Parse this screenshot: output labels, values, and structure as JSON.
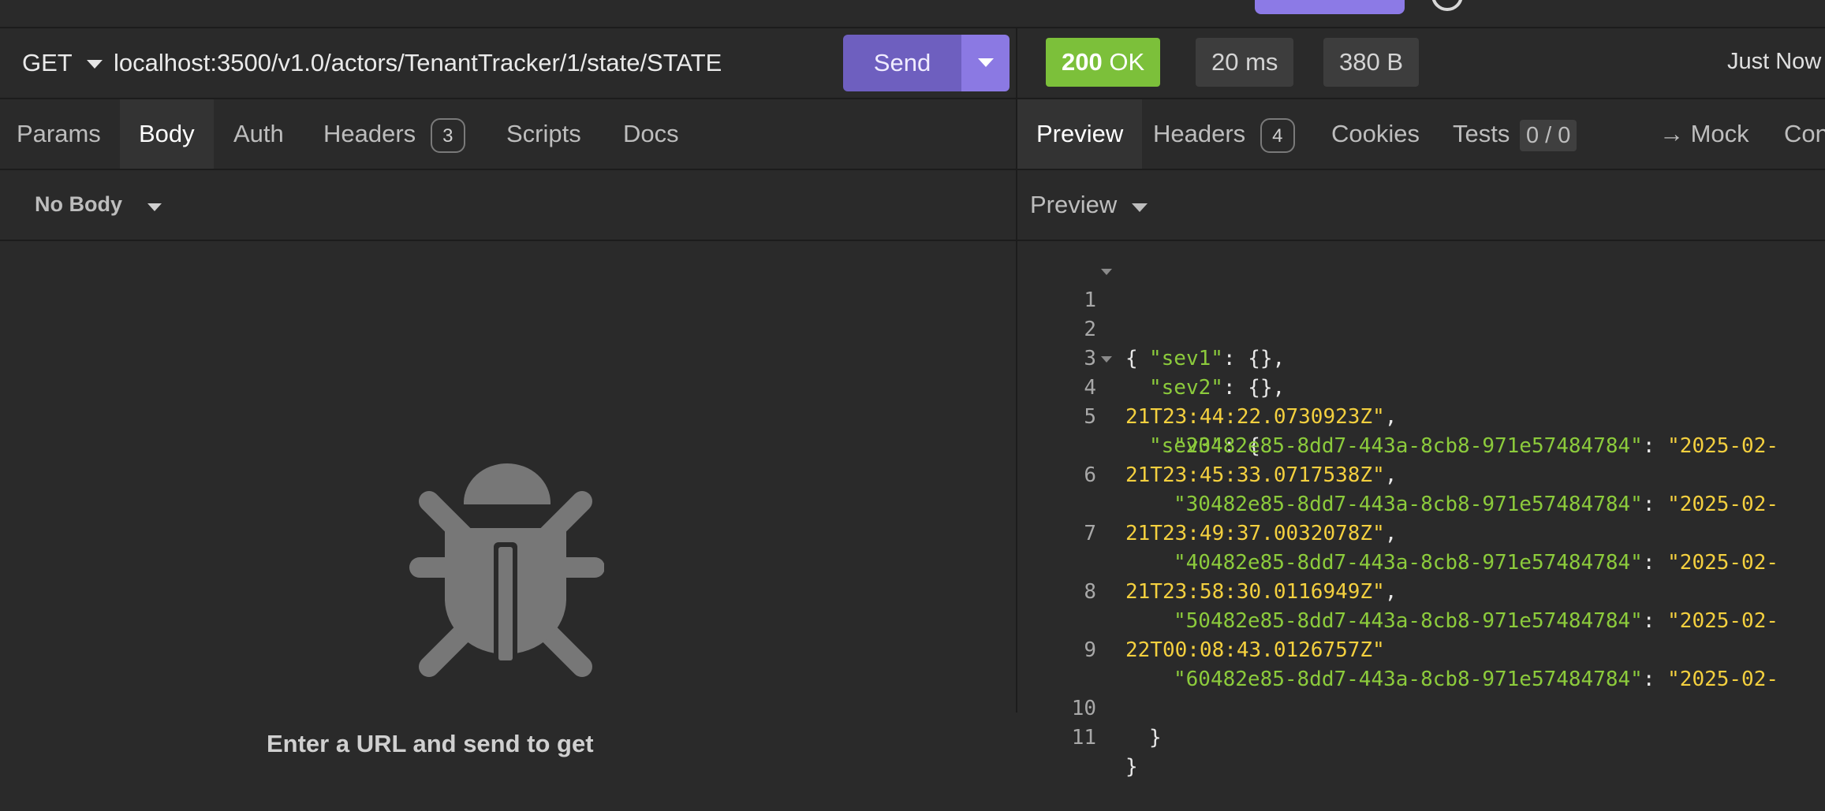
{
  "request": {
    "method": "GET",
    "url": "localhost:3500/v1.0/actors/TenantTracker/1/state/STATE",
    "send_label": "Send",
    "tabs": [
      {
        "label": "Params"
      },
      {
        "label": "Body"
      },
      {
        "label": "Auth"
      },
      {
        "label": "Headers",
        "badge": "3"
      },
      {
        "label": "Scripts"
      },
      {
        "label": "Docs"
      }
    ],
    "body_mode": "No Body",
    "hint_text": "Enter a URL and send to get"
  },
  "response": {
    "status_code": "200",
    "status_text": "OK",
    "time": "20 ms",
    "size": "380 B",
    "timestamp": "Just Now",
    "tabs": [
      {
        "label": "Preview"
      },
      {
        "label": "Headers",
        "badge": "4"
      },
      {
        "label": "Cookies"
      },
      {
        "label": "Tests",
        "badge": "0 / 0"
      },
      {
        "label": "→ Mock"
      },
      {
        "label": "Cons"
      }
    ],
    "preview_mode": "Preview",
    "lines": [
      {
        "n": "1",
        "open": "{"
      },
      {
        "n": "2",
        "key": "\"sev1\"",
        "rest": ": {},"
      },
      {
        "n": "3",
        "key": "\"sev2\"",
        "rest": ": {},"
      },
      {
        "n": "4",
        "key": "\"sev3\"",
        "rest": ": {"
      },
      {
        "n": "5",
        "key": "\"20482e85-8dd7-443a-8cb8-971e57484784\"",
        "sep": ": ",
        "val1": "\"2025-02-",
        "val2": "21T23:44:22.0730923Z\"",
        "end": ","
      },
      {
        "n": "6",
        "key": "\"30482e85-8dd7-443a-8cb8-971e57484784\"",
        "sep": ": ",
        "val1": "\"2025-02-",
        "val2": "21T23:45:33.0717538Z\"",
        "end": ","
      },
      {
        "n": "7",
        "key": "\"40482e85-8dd7-443a-8cb8-971e57484784\"",
        "sep": ": ",
        "val1": "\"2025-02-",
        "val2": "21T23:49:37.0032078Z\"",
        "end": ","
      },
      {
        "n": "8",
        "key": "\"50482e85-8dd7-443a-8cb8-971e57484784\"",
        "sep": ": ",
        "val1": "\"2025-02-",
        "val2": "21T23:58:30.0116949Z\"",
        "end": ","
      },
      {
        "n": "9",
        "key": "\"60482e85-8dd7-443a-8cb8-971e57484784\"",
        "sep": ": ",
        "val1": "\"2025-02-",
        "val2": "22T00:08:43.0126757Z\"",
        "end": ""
      },
      {
        "n": "10",
        "close": "}"
      },
      {
        "n": "11",
        "close": "}"
      }
    ]
  }
}
